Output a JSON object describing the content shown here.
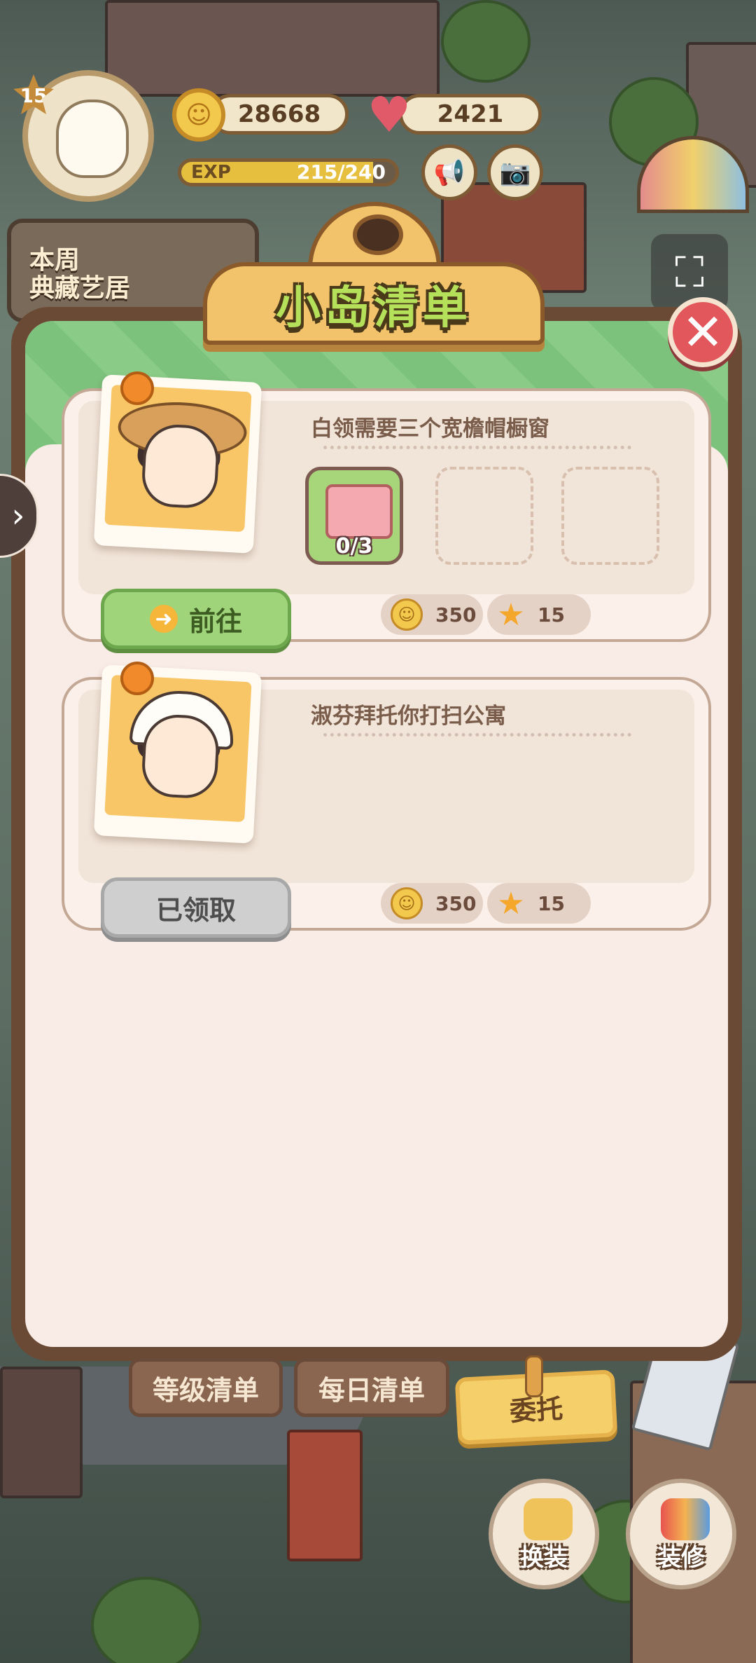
{
  "hud": {
    "level": "15",
    "coins": "28668",
    "hearts": "2421",
    "exp_label": "EXP",
    "exp_value": "215/240",
    "exp_progress": 0.896,
    "weekly_banner": "本周\n典藏艺居"
  },
  "panel": {
    "title": "小岛清单",
    "close_icon": "close-icon"
  },
  "tasks": [
    {
      "title": "白领需要三个宽檐帽橱窗",
      "item_count": "0/3",
      "button": "前往",
      "reward_coins": "350",
      "reward_stars": "15"
    },
    {
      "title": "淑芬拜托你打扫公寓",
      "button": "已领取",
      "reward_coins": "350",
      "reward_stars": "15"
    }
  ],
  "tabs": {
    "level_list": "等级清单",
    "daily_list": "每日清单",
    "commission": "委托"
  },
  "actions": {
    "outfit": "换装",
    "decorate": "装修"
  },
  "colors": {
    "accent_green": "#9fd47a",
    "panel_brown": "#6b4a35",
    "title_gold": "#f2c36a",
    "close_red": "#e2575b"
  }
}
